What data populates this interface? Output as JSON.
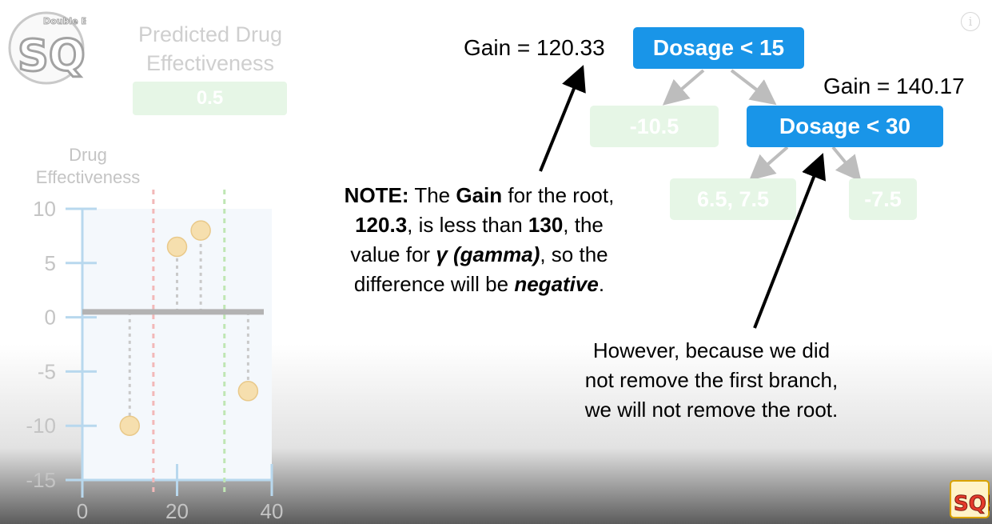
{
  "channel": {
    "logo_text": "SQ!",
    "logo_caption": "Double BAM!!"
  },
  "prediction": {
    "title": "Predicted Drug Effectiveness",
    "value": "0.5"
  },
  "chart_data": {
    "type": "scatter",
    "ylabel": "Drug Effectiveness",
    "xlabel": "",
    "x_ticks": [
      "0",
      "20",
      "40"
    ],
    "y_ticks": [
      "10",
      "5",
      "0",
      "-5",
      "-10",
      "-15"
    ],
    "xlim": [
      0,
      40
    ],
    "ylim": [
      -15,
      10
    ],
    "points": [
      {
        "x": 10,
        "y": -10
      },
      {
        "x": 20,
        "y": 6.5
      },
      {
        "x": 25,
        "y": 8
      },
      {
        "x": 35,
        "y": -6.8
      }
    ],
    "prediction_line_y": 0.5,
    "thresholds": [
      {
        "x": 15,
        "color": "#f2b8b8"
      },
      {
        "x": 30,
        "color": "#bfe6b3"
      }
    ]
  },
  "tree": {
    "root": {
      "label": "Dosage < 15",
      "gain": "Gain = 120.33"
    },
    "left_leaf": "-10.5",
    "inner": {
      "label": "Dosage < 30",
      "gain": "Gain = 140.17"
    },
    "inner_left_leaf": "6.5, 7.5",
    "inner_right_leaf": "-7.5"
  },
  "note": {
    "prefix": "NOTE:",
    "t1": " The ",
    "gain_word": "Gain",
    "t2": " for the root,",
    "value_root": "120.3",
    "t3": ", is less than ",
    "value_130": "130",
    "t4": ", the",
    "t5": "value for ",
    "gamma": "γ (gamma)",
    "t6": ", so the",
    "t7": "difference will be ",
    "negative": "negative",
    "t8": "."
  },
  "however": {
    "line1": "However, because we did",
    "line2": "not remove the first branch,",
    "line3": "we will not remove the root."
  },
  "colors": {
    "node_blue": "#1995e8",
    "leaf_green": "#e6f6e6",
    "axis_blue": "#b8d8ee",
    "point_fill": "#f6dfae",
    "tree_arrow": "#bdbdbd"
  },
  "icons": [
    "info-icon",
    "logo-icon",
    "arrow-icon"
  ]
}
